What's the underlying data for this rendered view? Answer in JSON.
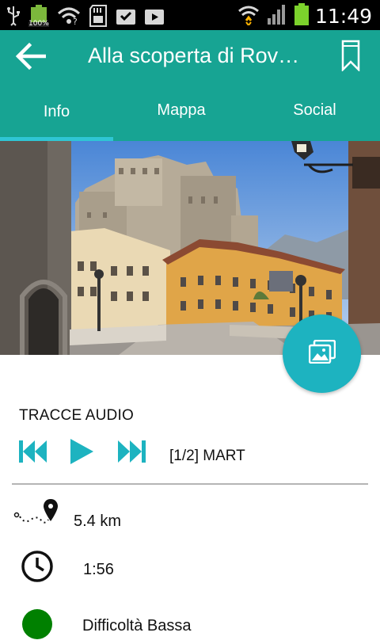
{
  "status_bar": {
    "time": "11:49",
    "battery_small_label": "100%",
    "left_icons": [
      "usb-icon",
      "battery-full-icon",
      "wifi-question-icon",
      "sd-card-icon",
      "download-done-icon",
      "video-download-icon"
    ],
    "right_icons": [
      "wifi-signal-icon",
      "cell-signal-icon",
      "battery-icon"
    ]
  },
  "app_bar": {
    "back_icon": "arrow-left-icon",
    "title": "Alla scoperta di Rov…",
    "bookmark_icon": "bookmark-icon"
  },
  "tabs": [
    {
      "label": "Info",
      "active": true
    },
    {
      "label": "Mappa",
      "active": false
    },
    {
      "label": "Social",
      "active": false
    }
  ],
  "hero": {
    "subject": "castle-photo",
    "fab_icon": "gallery-icon"
  },
  "audio": {
    "section_title": "TRACCE AUDIO",
    "controls": [
      "skip-previous-icon",
      "play-icon",
      "skip-next-icon"
    ],
    "track_label": "[1/2] MART"
  },
  "details": {
    "distance": "5.4 km",
    "duration": "1:56",
    "difficulty": "Difficoltà Bassa"
  },
  "colors": {
    "primary": "#17a493",
    "accent": "#1db3c0",
    "indicator": "#2fc6d4",
    "difficulty_dot": "#008000"
  }
}
